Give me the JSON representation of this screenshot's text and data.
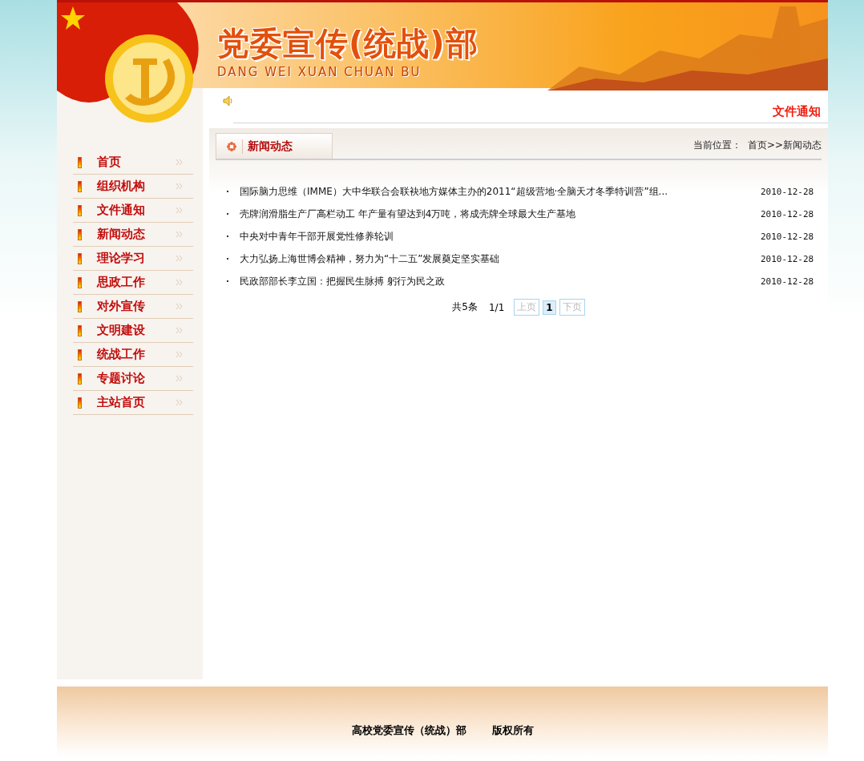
{
  "header": {
    "title": "党委宣传(统战)部",
    "subtitle": "DANG WEI XUAN CHUAN BU"
  },
  "notice": {
    "text": "文件通知"
  },
  "sidebar": {
    "items": [
      {
        "label": "首页"
      },
      {
        "label": "组织机构"
      },
      {
        "label": "文件通知"
      },
      {
        "label": "新闻动态"
      },
      {
        "label": "理论学习"
      },
      {
        "label": "思政工作"
      },
      {
        "label": "对外宣传"
      },
      {
        "label": "文明建设"
      },
      {
        "label": "统战工作"
      },
      {
        "label": "专题讨论"
      },
      {
        "label": "主站首页"
      }
    ]
  },
  "section": {
    "title": "新闻动态",
    "location_label": "当前位置：",
    "breadcrumb": "首页>>新闻动态"
  },
  "news": [
    {
      "title": "国际脑力思维（IMME）大中华联合会联袂地方媒体主办的2011“超级营地·全脑天才冬季特训营”组...",
      "date": "2010-12-28"
    },
    {
      "title": "壳牌润滑脂生产厂高栏动工 年产量有望达到4万吨，将成壳牌全球最大生产基地",
      "date": "2010-12-28"
    },
    {
      "title": "中央对中青年干部开展党性修养轮训",
      "date": "2010-12-28"
    },
    {
      "title": "大力弘扬上海世博会精神，努力为“十二五”发展奠定坚实基础",
      "date": "2010-12-28"
    },
    {
      "title": "民政部部长李立国：把握民生脉搏 躬行为民之政",
      "date": "2010-12-28"
    }
  ],
  "pagination": {
    "total": "共5条",
    "pages": "1/1",
    "buttons": [
      {
        "label": "上页",
        "disabled": true,
        "selected": false
      },
      {
        "label": "1",
        "disabled": false,
        "selected": true
      },
      {
        "label": "下页",
        "disabled": true,
        "selected": false
      }
    ]
  },
  "footer": {
    "owner": "高校党委宣传（统战）部",
    "rights": "版权所有"
  }
}
